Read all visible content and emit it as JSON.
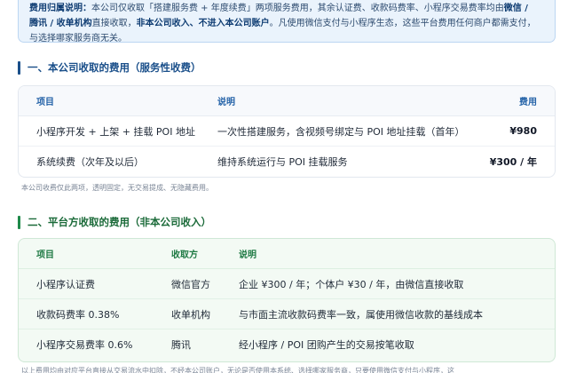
{
  "notice": {
    "line1_prefix": "费用归属说明：",
    "line1_text": "本公司仅收取「搭建服务费 + 年度续费」两项服务费用，其余认证费、收款码费率、小程序交易费率均由",
    "line1_strong": "微信 /",
    "line2_strong1": "腾讯 / 收单机构",
    "line2_text1": "直接收取，",
    "line2_strong2": "非本公司收入、不进入本公司账户",
    "line2_text2": "。凡使用微信支付与小程序生态，这些平台费用任何商户都需支付，",
    "line3_text": "与选择哪家服务商无关。"
  },
  "section1": {
    "title": "一、本公司收取的费用（服务性收费）",
    "headers": {
      "item": "项目",
      "desc": "说明",
      "fee": "费用"
    },
    "rows": [
      {
        "item": "小程序开发 + 上架 + 挂载 POI 地址",
        "desc": "一次性搭建服务，含视频号绑定与 POI 地址挂载（首年）",
        "fee": "¥980"
      },
      {
        "item": "系统续费（次年及以后）",
        "desc": "维持系统运行与 POI 挂载服务",
        "fee": "¥300 / 年"
      }
    ],
    "note": "本公司收费仅此两项，透明固定，无交易提成、无隐藏费用。"
  },
  "section2": {
    "title": "二、平台方收取的费用（非本公司收入）",
    "headers": {
      "item": "项目",
      "collector": "收取方",
      "desc": "说明"
    },
    "rows": [
      {
        "item": "小程序认证费",
        "collector": "微信官方",
        "desc": "企业 ¥300 / 年；个体户 ¥30 / 年，由微信直接收取"
      },
      {
        "item": "收款码费率 0.38%",
        "collector": "收单机构",
        "desc": "与市面主流收款码费率一致，属使用微信收款的基线成本"
      },
      {
        "item": "小程序交易费率 0.6%",
        "collector": "腾讯",
        "desc": "经小程序 / POI 团购产生的交易按笔收取"
      }
    ],
    "note": "以上费用均由对应平台直接从交易流水中扣除，不经本公司账户，无论是否使用本系统、选择哪家服务商，只要使用微信支付与小程序，这"
  }
}
